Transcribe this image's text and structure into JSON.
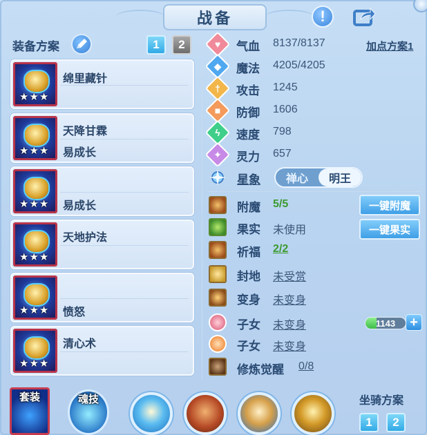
{
  "title": "战备",
  "equip_panel": {
    "plan_label": "装备方案",
    "plans": [
      "1",
      "2"
    ],
    "items": [
      {
        "line1": "绵里藏针",
        "line2": "",
        "stars": "★★★"
      },
      {
        "line1": "天降甘霖",
        "line2": "易成长",
        "stars": "★★★"
      },
      {
        "line1": "",
        "line2": "易成长",
        "stars": "★★★"
      },
      {
        "line1": "天地护法",
        "line2": "",
        "stars": "★★★"
      },
      {
        "line1": "",
        "line2": "愤怒",
        "stars": "★★★"
      },
      {
        "line1": "清心术",
        "line2": "",
        "stars": "★★★"
      }
    ]
  },
  "stats": {
    "addpoint_label": "加点方案1",
    "rows": [
      {
        "label": "气血",
        "value": "8137/8137",
        "icon": "heart-icon",
        "color": "#f08a9a"
      },
      {
        "label": "魔法",
        "value": "4205/4205",
        "icon": "mana-icon",
        "color": "#4fa8f0"
      },
      {
        "label": "攻击",
        "value": "1245",
        "icon": "attack-icon",
        "color": "#f2b64a"
      },
      {
        "label": "防御",
        "value": "1606",
        "icon": "shield-icon",
        "color": "#f39a5c"
      },
      {
        "label": "速度",
        "value": "798",
        "icon": "speed-icon",
        "color": "#3fcf8a"
      },
      {
        "label": "灵力",
        "value": "657",
        "icon": "spirit-icon",
        "color": "#c78ae6"
      }
    ]
  },
  "star_sign": {
    "label": "星象",
    "options": [
      "禅心",
      "明王"
    ],
    "selected": "明王"
  },
  "extras": {
    "enchant": {
      "label": "附魔",
      "value": "5/5",
      "button": "一键附魔"
    },
    "fruit": {
      "label": "果实",
      "value": "未使用",
      "button": "一键果实"
    },
    "blessing": {
      "label": "祈福",
      "value": "2/2"
    },
    "seal": {
      "label": "封地",
      "value": "未受赏"
    },
    "transform": {
      "label": "变身",
      "value": "未变身"
    },
    "child1": {
      "label": "子女",
      "value": "未变身"
    },
    "child2": {
      "label": "子女",
      "value": "未变身"
    },
    "awaken": {
      "label": "修炼觉醒",
      "value": "0/8"
    }
  },
  "exp_bar": {
    "value": "1143",
    "fill_percent": 28
  },
  "bottom": {
    "suit_label": "套装",
    "soul_label": "魂技",
    "mount_label": "坐骑方案",
    "mount_plans": [
      "1",
      "2"
    ]
  }
}
